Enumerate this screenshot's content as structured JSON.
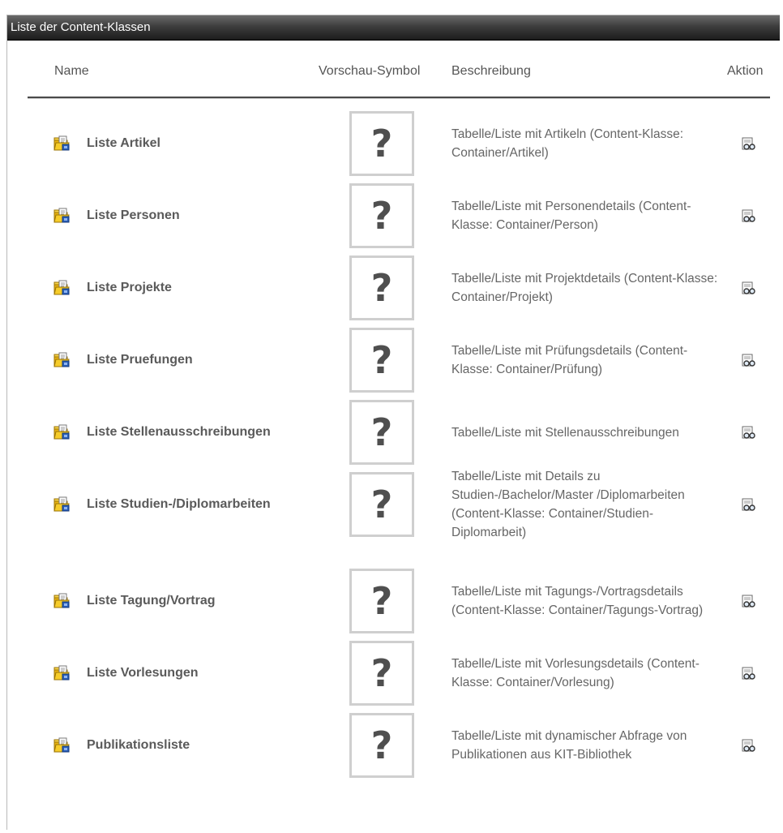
{
  "window": {
    "title": "Liste der Content-Klassen"
  },
  "table": {
    "columns": {
      "name": "Name",
      "preview": "Vorschau-Symbol",
      "description": "Beschreibung",
      "action": "Aktion"
    },
    "preview_symbol": "?",
    "rows": [
      {
        "name": "Liste Artikel",
        "description": "Tabelle/Liste mit Artikeln (Content-Klasse: Container/Artikel)"
      },
      {
        "name": "Liste Personen",
        "description": "Tabelle/Liste mit Personendetails (Content-Klasse: Container/Person)"
      },
      {
        "name": "Liste Projekte",
        "description": "Tabelle/Liste mit Projektdetails (Content-Klasse: Container/Projekt)"
      },
      {
        "name": "Liste Pruefungen",
        "description": "Tabelle/Liste mit Prüfungsdetails (Content-Klasse: Container/Prüfung)"
      },
      {
        "name": "Liste Stellenausschreibungen",
        "description": "Tabelle/Liste mit Stellenausschreibungen"
      },
      {
        "name": "Liste Studien-/Diplomarbeiten",
        "description": "Tabelle/Liste mit Details zu Studien-/Bachelor/Master /Diplomarbeiten (Content-Klasse: Container/Studien-Diplomarbeit)"
      },
      {
        "name": "Liste Tagung/Vortrag",
        "description": "Tabelle/Liste mit Tagungs-/Vortragsdetails (Content-Klasse: Container/Tagungs-Vortrag)"
      },
      {
        "name": "Liste Vorlesungen",
        "description": "Tabelle/Liste mit Vorlesungsdetails (Content-Klasse: Container/Vorlesung)"
      },
      {
        "name": "Publikationsliste",
        "description": "Tabelle/Liste mit dynamischer Abfrage von Publikationen aus KIT-Bibliothek"
      }
    ]
  },
  "icons": {
    "row_icon": "folder-with-document-icon",
    "action_icon": "preview-glasses-icon"
  },
  "colors": {
    "titlebar": "#1c1c1c",
    "folder": "#f2c21a",
    "folder_doc": "#2a5fb8"
  }
}
